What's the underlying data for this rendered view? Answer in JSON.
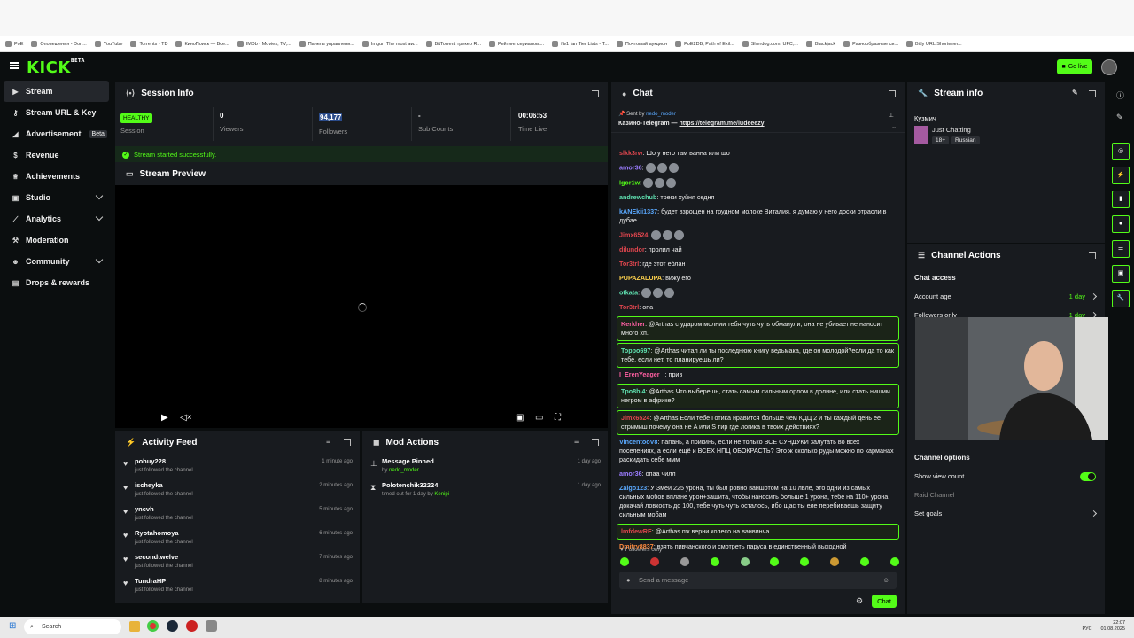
{
  "bookmarks": [
    "PoE",
    "Оповещения - Don...",
    "YouTube",
    "Torrents - TD",
    "КиноПоиск — Все...",
    "IMDb - Movies, TV,...",
    "Панель управлени...",
    "Imgur: The most aw...",
    "BitTorrent трекер R...",
    "Рейтинг сериалов:...",
    "№1 fan Tier Lists - T...",
    "Почтовый аукцион",
    "PoE2DB, Path of Exil...",
    "Sherdog.com: UFC,...",
    "Blackjack",
    "Разнообразные си...",
    "Bitly URL Shortener..."
  ],
  "brand": {
    "logo": "KICK",
    "logo_sup": "BETA",
    "go_live": "Go live",
    "accent": "#53fc18"
  },
  "sidebar": {
    "items": [
      {
        "label": "Stream",
        "icon": "play-icon"
      },
      {
        "label": "Stream URL & Key",
        "icon": "key-icon"
      },
      {
        "label": "Advertisement",
        "icon": "megaphone-icon",
        "badge": "Beta"
      },
      {
        "label": "Revenue",
        "icon": "dollar-icon"
      },
      {
        "label": "Achievements",
        "icon": "trophy-icon"
      },
      {
        "label": "Studio",
        "icon": "studio-icon"
      },
      {
        "label": "Analytics",
        "icon": "chart-icon"
      },
      {
        "label": "Moderation",
        "icon": "hammer-icon"
      },
      {
        "label": "Community",
        "icon": "users-icon"
      },
      {
        "label": "Drops & rewards",
        "icon": "gift-icon"
      }
    ]
  },
  "session": {
    "title": "Session Info",
    "health": "HEALTHY",
    "health_label": "Session",
    "viewers": "0",
    "viewers_label": "Viewers",
    "followers": "94,177",
    "followers_label": "Followers",
    "subs": "-",
    "subs_label": "Sub Counts",
    "time": "00:06:53",
    "time_label": "Time Live",
    "status": "Stream started successfully."
  },
  "preview": {
    "title": "Stream Preview"
  },
  "activity": {
    "title": "Activity Feed",
    "items": [
      {
        "name": "pohuy228",
        "desc": "just followed the channel",
        "time": "1 minute ago"
      },
      {
        "name": "ischeyka",
        "desc": "just followed the channel",
        "time": "2 minutes ago"
      },
      {
        "name": "yncvh",
        "desc": "just followed the channel",
        "time": "5 minutes ago"
      },
      {
        "name": "Ryotahomoya",
        "desc": "just followed the channel",
        "time": "6 minutes ago"
      },
      {
        "name": "secondtwelve",
        "desc": "just followed the channel",
        "time": "7 minutes ago"
      },
      {
        "name": "TundraHP",
        "desc": "just followed the channel",
        "time": "8 minutes ago"
      }
    ]
  },
  "mod": {
    "title": "Mod Actions",
    "items": [
      {
        "title": "Message Pinned",
        "by": "by ",
        "who": "nedo_moder",
        "time": "1 day ago"
      },
      {
        "title": "Polotenchik32224",
        "by": "timed out for 1 day by ",
        "who": "Kenipi",
        "time": "1 day ago"
      }
    ]
  },
  "chat": {
    "title": "Chat",
    "pinned_by": "Sent by",
    "pinned_user": "nedo_moder",
    "pinned_text": "Казино-Telegram —",
    "pinned_link": "https://telegram.me/ludeeezy",
    "messages": [
      {
        "user": "slkk3rw",
        "color": "#e0464e",
        "text": "Шо у него там ванна или шо"
      },
      {
        "user": "amor36",
        "color": "#9b7cff",
        "text": ""
      },
      {
        "user": "Igor1w",
        "color": "#53fc18",
        "text": ""
      },
      {
        "user": "andrewchub",
        "color": "#5fe0b0",
        "text": "треки хуйня седня"
      },
      {
        "user": "kANEkii1337",
        "color": "#5aa9ff",
        "text": "будет взрощен на грудном молоке Виталия, я думаю у него доски отрасли в дубае"
      },
      {
        "user": "Jimx6524",
        "color": "#e0464e",
        "text": ""
      },
      {
        "user": "dilundor",
        "color": "#e0464e",
        "text": "пролил чай"
      },
      {
        "user": "Tor3trl",
        "color": "#e0464e",
        "text": "где этот еблан"
      },
      {
        "user": "PUPAZALUPA",
        "color": "#ffd34d",
        "text": "вижу его"
      },
      {
        "user": "otkata",
        "color": "#5fe0b0",
        "text": ""
      },
      {
        "user": "Tor3trl",
        "color": "#e0464e",
        "text": "опа"
      },
      {
        "user": "Kerkher",
        "color": "#ff5fa2",
        "text": "@Arthas с ударом молнии тебя чуть чуть обманули, она не убивает не наносит много хп.",
        "hl": true
      },
      {
        "user": "Toppo697",
        "color": "#5fe0b0",
        "text": "@Arthas читал ли ты последнюю книгу ведьмака, где он молодой?если да то как тебе, если нет, то планируешь ли?",
        "hl": true
      },
      {
        "user": "I_ErenYeager_I",
        "color": "#ff5fa2",
        "text": "прив"
      },
      {
        "user": "Tpo8bl4",
        "color": "#5fe0b0",
        "text": "@Arthas Что выберешь, стать самым сильным орлом в долине, или стать нищим негром в африке?",
        "hl": true
      },
      {
        "user": "Jimx6524",
        "color": "#e0464e",
        "text": "@Arthas Если тебе Готика нравится больше чем КДЦ 2 и ты каждый день её стримиш почему она не A или S тир где логика в твоих действиях?",
        "hl": true
      },
      {
        "user": "VincentooV8",
        "color": "#5aa9ff",
        "text": "папань, а прикинь, если не только ВСЕ СУНДУКИ залутать во всех поселениях, а если ещё и ВСЕХ НПЦ ОБОКРАСТЬ? Это ж сколько руды можно по карманах раскидать себе ммм"
      },
      {
        "user": "amor36",
        "color": "#9b7cff",
        "text": "опаа чилл"
      },
      {
        "user": "Zalgo123",
        "color": "#5aa9ff",
        "text": "У Змеи 225 урона, ты был ровно ваншотом на 10 лвле, это одни из самых сильных мобов вплане урон+защита, чтобы наносить больше 1 урона, тебе на 110+ урона, докачай ловкость до 100, тебе чуть чуть осталось, ибо щас ты еле перебиваешь защиту сильным мобам"
      },
      {
        "user": "lmfdewRE",
        "color": "#e0464e",
        "text": "@Arthas пж верни колесо на ванвинча",
        "hl": true
      },
      {
        "user": "Dmitry8837",
        "color": "#ff8a3d",
        "text": "взять пивчанского и смотреть паруса в единственный выходной"
      }
    ],
    "followers_only": "Followers only",
    "placeholder": "Send a message",
    "send": "Chat"
  },
  "stream_info": {
    "title": "Stream info",
    "streamer": "Кузмич",
    "category": "Just Chatting",
    "age_tag": "18+",
    "language": "Russian"
  },
  "channel_actions": {
    "title": "Channel Actions",
    "chat_access": "Chat access",
    "account_age": "Account age",
    "account_age_val": "1 day",
    "followers_only": "Followers only",
    "followers_only_val": "1 day",
    "options": "Channel options",
    "show_view_count": "Show view count",
    "raid": "Raid Channel",
    "set_goals": "Set goals"
  },
  "taskbar": {
    "search": "Search",
    "lang": "РУС",
    "time": "22:07",
    "date": "01.08.2025"
  }
}
